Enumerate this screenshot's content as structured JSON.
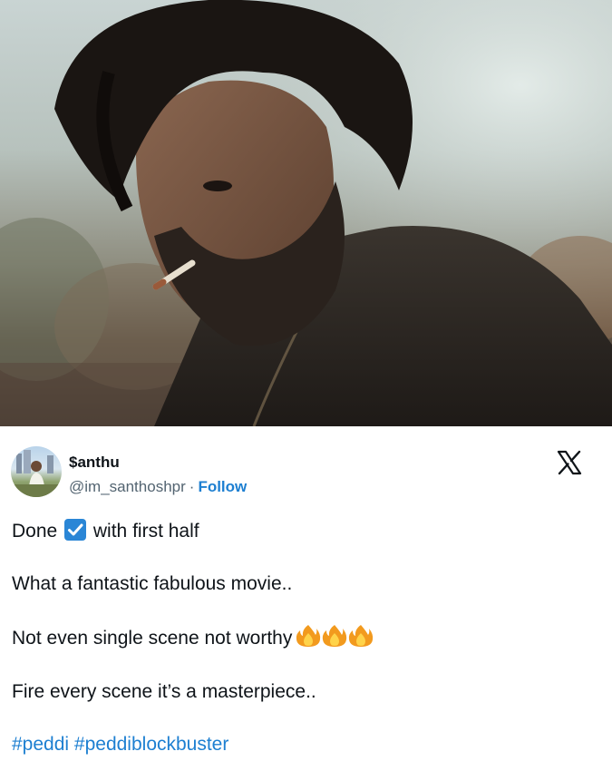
{
  "hero_image": {
    "description_icon": "movie-still-image"
  },
  "tweet": {
    "author": {
      "display_name": "$anthu",
      "handle": "@im_santhoshpr",
      "separator": "·",
      "follow_label": "Follow",
      "avatar_icon": "avatar-photo"
    },
    "platform_icon": "x-logo-icon",
    "lines": {
      "l1_before": "Done",
      "l1_after": "with first half",
      "l2": "What a fantastic fabulous movie..",
      "l3": "Not even single scene not worthy",
      "l4": "Fire every scene it’s a masterpiece..",
      "hashtag1": "#peddi",
      "hashtag2": "#peddiblockbuster"
    },
    "emoji": {
      "check": "check-mark-button-icon",
      "fire_count": 3,
      "fire": "fire-icon"
    }
  },
  "colors": {
    "link": "#1d7fd1",
    "text": "#0f1419",
    "muted": "#536471",
    "check_blue": "#2a86d6"
  }
}
